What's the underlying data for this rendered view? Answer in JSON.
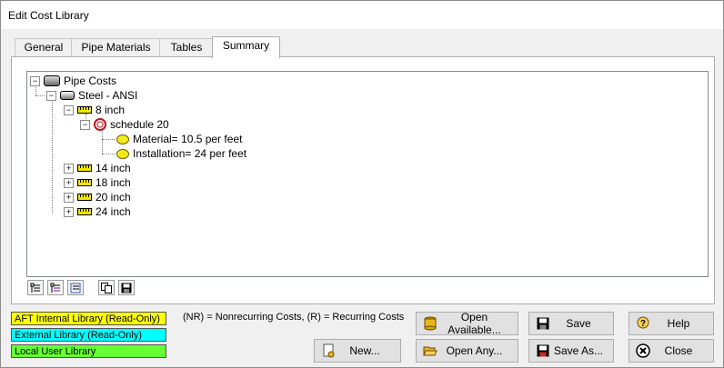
{
  "window": {
    "title": "Edit Cost Library"
  },
  "tabs": [
    {
      "label": "General"
    },
    {
      "label": "Pipe Materials"
    },
    {
      "label": "Tables"
    },
    {
      "label": "Summary"
    }
  ],
  "tree": {
    "root": "Pipe Costs",
    "library": "Steel - ANSI",
    "size_8": "8 inch",
    "schedule": "schedule 20",
    "material": "Material= 10.5 per feet",
    "installation": "Installation= 24 per feet",
    "size_14": "14 inch",
    "size_18": "18 inch",
    "size_20": "20 inch",
    "size_24": "24 inch",
    "collapsed_symbol": "⊟",
    "expand_symbol": "+",
    "minus_symbol": "−"
  },
  "legend": {
    "aft": {
      "label": "AFT Internal Library (Read-Only)",
      "color": "#ffff00"
    },
    "external": {
      "label": "External Library (Read-Only)",
      "color": "#00ffff"
    },
    "local": {
      "label": "Local User Library",
      "color": "#66ff33"
    }
  },
  "note": "(NR) = Nonrecurring Costs, (R) = Recurring Costs",
  "buttons": {
    "open_available": "Open Available...",
    "open_any": "Open Any...",
    "new": "New...",
    "save": "Save",
    "save_as": "Save As...",
    "help": "Help",
    "close": "Close"
  }
}
